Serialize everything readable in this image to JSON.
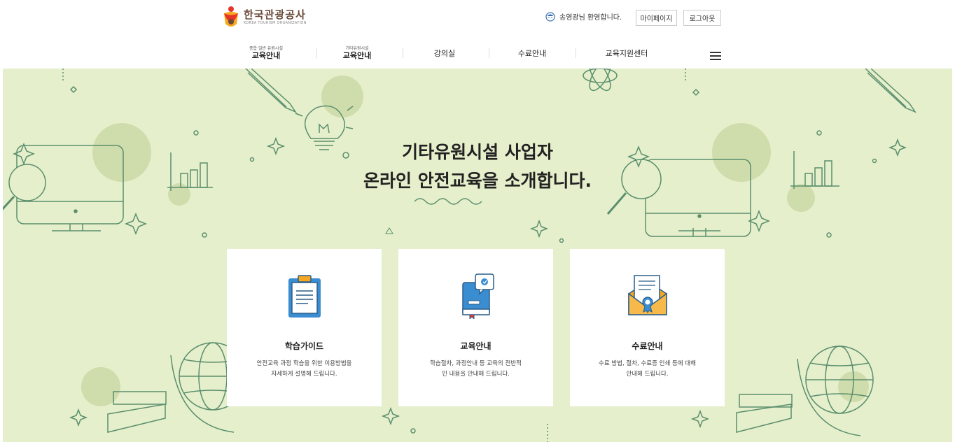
{
  "header": {
    "logo_name": "한국관광공사",
    "logo_sub": "KOREA TOURISM ORGANIZATION",
    "welcome": "송영광님 환영합니다.",
    "mypage_label": "마이페이지",
    "logout_label": "로그아웃"
  },
  "nav": {
    "items": [
      {
        "small": "종합·일반 유원시설",
        "label": "교육안내"
      },
      {
        "small": "기타유원시설",
        "label": "교육안내"
      },
      {
        "label": "강의실"
      },
      {
        "label": "수료안내"
      },
      {
        "label": "교육지원센터"
      }
    ],
    "menu_icon": "hamburger-menu-icon"
  },
  "hero": {
    "title_line1": "기타유원시설 사업자",
    "title_line2": "온라인 안전교육을 소개합니다.",
    "background_color": "#e6efcb",
    "decoration_color": "#5a8f6e"
  },
  "cards": [
    {
      "title": "학습가이드",
      "desc_line1": "안전교육 과정 학습을 위한 이용방법을",
      "desc_line2": "자세하게 설명해 드립니다.",
      "icon": "clipboard-icon"
    },
    {
      "title": "교육안내",
      "desc_line1": "학습절차, 과정안내 등 교육의 전반적",
      "desc_line2": "인 내용을 안내해 드립니다.",
      "icon": "book-icon"
    },
    {
      "title": "수료안내",
      "desc_line1": "수료 방법, 절차, 수료증 인쇄 등에 대해",
      "desc_line2": "안내해 드립니다.",
      "icon": "certificate-envelope-icon"
    }
  ]
}
